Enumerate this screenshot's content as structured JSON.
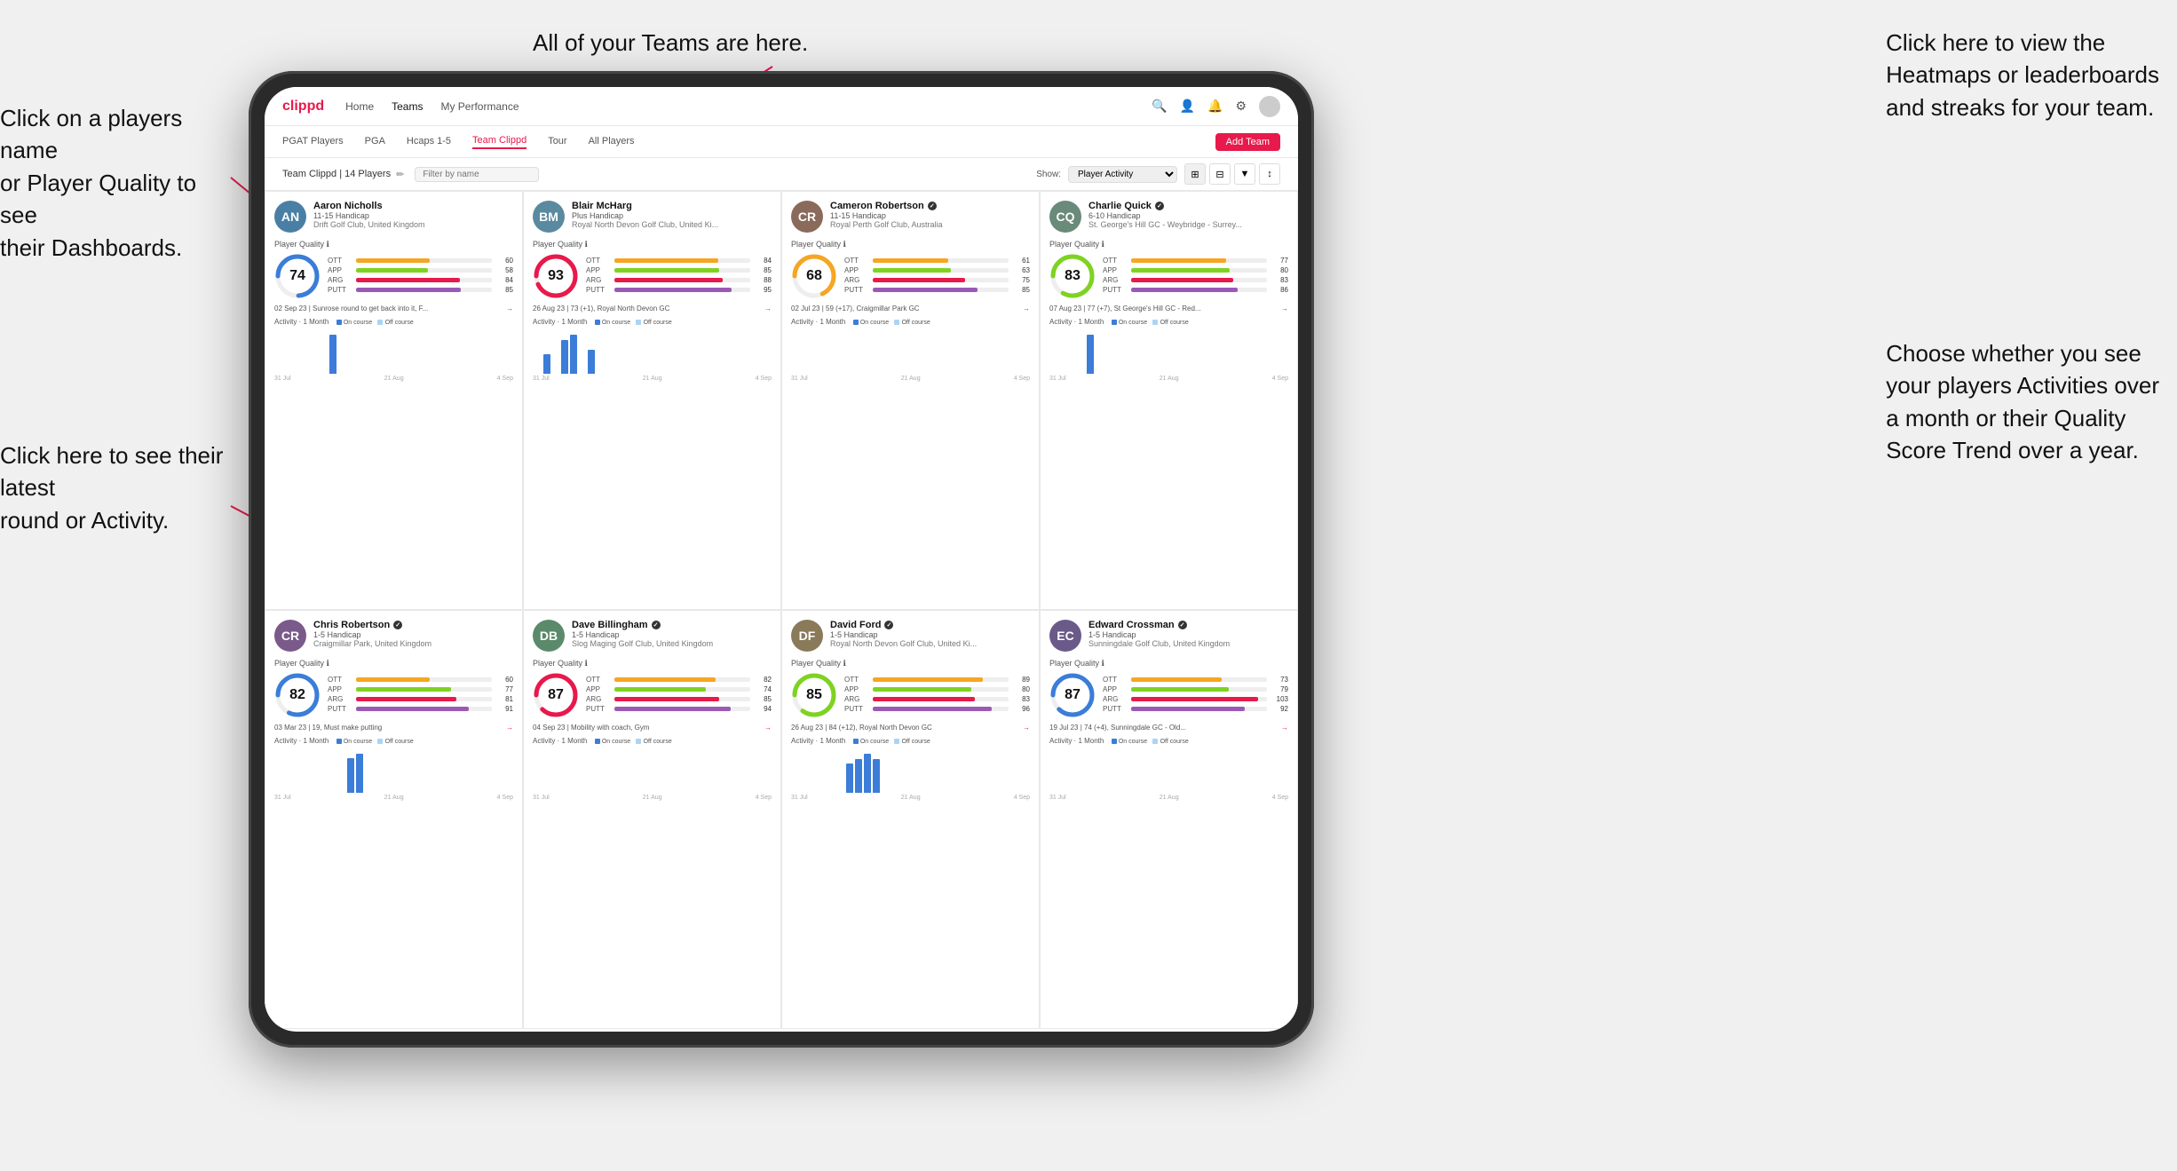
{
  "annotations": {
    "top_left": "Click on a players name\nor Player Quality to see\ntheir Dashboards.",
    "bottom_left": "Click here to see their latest\nround or Activity.",
    "top_center": "All of your Teams are here.",
    "top_right": "Click here to view the\nHeatmaps or leaderboards\nand streaks for your team.",
    "bottom_right": "Choose whether you see\nyour players Activities over\na month or their Quality\nScore Trend over a year."
  },
  "nav": {
    "logo": "clippd",
    "links": [
      "Home",
      "Teams",
      "My Performance"
    ],
    "active": "Teams"
  },
  "sub_nav": {
    "links": [
      "PGAT Players",
      "PGA",
      "Hcaps 1-5",
      "Team Clippd",
      "Tour",
      "All Players"
    ],
    "active": "Team Clippd",
    "add_button": "Add Team"
  },
  "team_bar": {
    "title": "Team Clippd | 14 Players",
    "search_placeholder": "Filter by name",
    "show_label": "Show:",
    "show_option": "Player Activity",
    "view_icons": [
      "grid",
      "list",
      "filter",
      "sort"
    ]
  },
  "players": [
    {
      "name": "Aaron Nicholls",
      "handicap": "11-15 Handicap",
      "club": "Drift Golf Club, United Kingdom",
      "color": "#7a8fa6",
      "initials": "AN",
      "quality": 74,
      "quality_color": "#3b7dd8",
      "stats": {
        "OTT": {
          "value": 60,
          "color": "#f5a623"
        },
        "APP": {
          "value": 58,
          "color": "#7ed321"
        },
        "ARG": {
          "value": 84,
          "color": "#e8194b"
        },
        "PUTT": {
          "value": 85,
          "color": "#9b59b6"
        }
      },
      "latest": "02 Sep 23 | Sunrose round to get back into it, F...",
      "activity_bars": [
        0,
        0,
        0,
        0,
        0,
        0,
        12,
        0,
        0,
        0
      ]
    },
    {
      "name": "Blair McHarg",
      "handicap": "Plus Handicap",
      "club": "Royal North Devon Golf Club, United Ki...",
      "color": "#5a7fa0",
      "initials": "BM",
      "quality": 93,
      "quality_color": "#e8194b",
      "stats": {
        "OTT": {
          "value": 84,
          "color": "#f5a623"
        },
        "APP": {
          "value": 85,
          "color": "#7ed321"
        },
        "ARG": {
          "value": 88,
          "color": "#e8194b"
        },
        "PUTT": {
          "value": 95,
          "color": "#9b59b6"
        }
      },
      "latest": "26 Aug 23 | 73 (+1), Royal North Devon GC",
      "activity_bars": [
        0,
        8,
        0,
        14,
        16,
        0,
        10,
        0,
        0,
        0
      ]
    },
    {
      "name": "Cameron Robertson",
      "handicap": "11-15 Handicap",
      "club": "Royal Perth Golf Club, Australia",
      "color": "#8a6a5a",
      "initials": "CR",
      "quality": 68,
      "quality_color": "#f5a623",
      "stats": {
        "OTT": {
          "value": 61,
          "color": "#f5a623"
        },
        "APP": {
          "value": 63,
          "color": "#7ed321"
        },
        "ARG": {
          "value": 75,
          "color": "#e8194b"
        },
        "PUTT": {
          "value": 85,
          "color": "#9b59b6"
        }
      },
      "latest": "02 Jul 23 | 59 (+17), Craigmillar Park GC",
      "activity_bars": [
        0,
        0,
        0,
        0,
        0,
        0,
        0,
        0,
        0,
        0
      ]
    },
    {
      "name": "Charlie Quick",
      "handicap": "6-10 Handicap",
      "club": "St. George's Hill GC - Weybridge - Surrey...",
      "color": "#6a8a7a",
      "initials": "CQ",
      "quality": 83,
      "quality_color": "#7ed321",
      "stats": {
        "OTT": {
          "value": 77,
          "color": "#f5a623"
        },
        "APP": {
          "value": 80,
          "color": "#7ed321"
        },
        "ARG": {
          "value": 83,
          "color": "#e8194b"
        },
        "PUTT": {
          "value": 86,
          "color": "#9b59b6"
        }
      },
      "latest": "07 Aug 23 | 77 (+7), St George's Hill GC - Red...",
      "activity_bars": [
        0,
        0,
        0,
        0,
        8,
        0,
        0,
        0,
        0,
        0
      ]
    },
    {
      "name": "Chris Robertson",
      "handicap": "1-5 Handicap",
      "club": "Craigmillar Park, United Kingdom",
      "color": "#7a5a8a",
      "initials": "CR",
      "quality": 82,
      "quality_color": "#3b7dd8",
      "stats": {
        "OTT": {
          "value": 60,
          "color": "#f5a623"
        },
        "APP": {
          "value": 77,
          "color": "#7ed321"
        },
        "ARG": {
          "value": 81,
          "color": "#e8194b"
        },
        "PUTT": {
          "value": 91,
          "color": "#9b59b6"
        }
      },
      "latest": "03 Mar 23 | 19, Must make putting",
      "activity_bars": [
        0,
        0,
        0,
        0,
        0,
        0,
        0,
        0,
        8,
        9
      ]
    },
    {
      "name": "Dave Billingham",
      "handicap": "1-5 Handicap",
      "club": "Slog Maging Golf Club, United Kingdom",
      "color": "#5a8a6a",
      "initials": "DB",
      "quality": 87,
      "quality_color": "#e8194b",
      "stats": {
        "OTT": {
          "value": 82,
          "color": "#f5a623"
        },
        "APP": {
          "value": 74,
          "color": "#7ed321"
        },
        "ARG": {
          "value": 85,
          "color": "#e8194b"
        },
        "PUTT": {
          "value": 94,
          "color": "#9b59b6"
        }
      },
      "latest": "04 Sep 23 | Mobility with coach, Gym",
      "activity_bars": [
        0,
        0,
        0,
        0,
        0,
        0,
        0,
        0,
        0,
        0
      ]
    },
    {
      "name": "David Ford",
      "handicap": "1-5 Handicap",
      "club": "Royal North Devon Golf Club, United Ki...",
      "color": "#8a7a5a",
      "initials": "DF",
      "quality": 85,
      "quality_color": "#7ed321",
      "stats": {
        "OTT": {
          "value": 89,
          "color": "#f5a623"
        },
        "APP": {
          "value": 80,
          "color": "#7ed321"
        },
        "ARG": {
          "value": 83,
          "color": "#e8194b"
        },
        "PUTT": {
          "value": 96,
          "color": "#9b59b6"
        }
      },
      "latest": "26 Aug 23 | 84 (+12), Royal North Devon GC",
      "activity_bars": [
        0,
        0,
        0,
        0,
        0,
        0,
        12,
        14,
        16,
        14
      ]
    },
    {
      "name": "Edward Crossman",
      "handicap": "1-5 Handicap",
      "club": "Sunningdale Golf Club, United Kingdom",
      "color": "#6a5a8a",
      "initials": "EC",
      "quality": 87,
      "quality_color": "#3b7dd8",
      "stats": {
        "OTT": {
          "value": 73,
          "color": "#f5a623"
        },
        "APP": {
          "value": 79,
          "color": "#7ed321"
        },
        "ARG": {
          "value": 103,
          "color": "#e8194b"
        },
        "PUTT": {
          "value": 92,
          "color": "#9b59b6"
        }
      },
      "latest": "19 Jul 23 | 74 (+4), Sunningdale GC - Old...",
      "activity_bars": [
        0,
        0,
        0,
        0,
        0,
        0,
        0,
        0,
        0,
        0
      ]
    }
  ],
  "activity": {
    "label": "Activity · 1 Month",
    "legend_on": "On course",
    "legend_off": "Off course",
    "axis_labels": [
      "31 Jul",
      "21 Aug",
      "4 Sep"
    ]
  }
}
